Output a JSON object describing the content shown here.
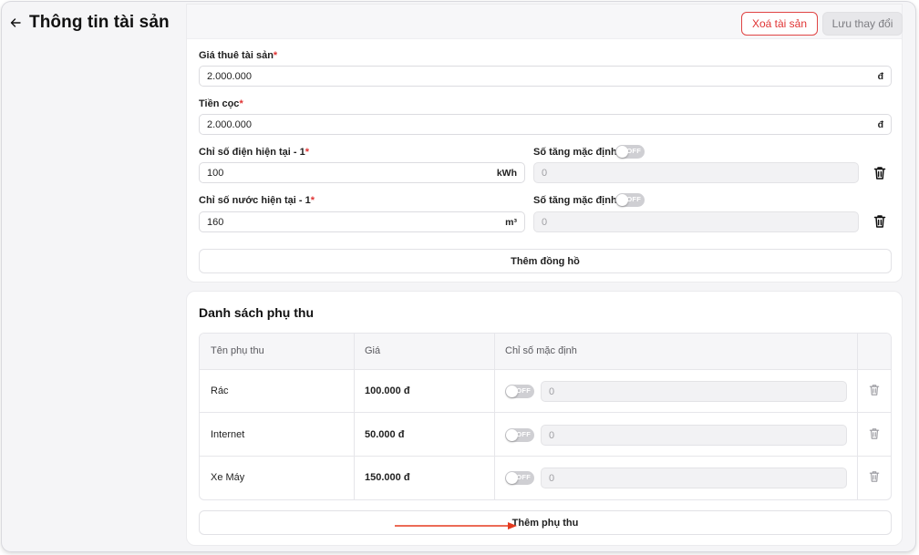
{
  "header": {
    "title": "Thông tin tài sản"
  },
  "toolbar": {
    "delete_label": "Xoá tài sản",
    "save_label": "Lưu thay đổi"
  },
  "rent": {
    "label": "Giá thuê tài sản",
    "value": "2.000.000",
    "unit": "đ"
  },
  "deposit": {
    "label": "Tiền cọc",
    "value": "2.000.000",
    "unit": "đ"
  },
  "meters": [
    {
      "label": "Chỉ số điện hiện tại - 1",
      "value": "100",
      "unit": "kWh",
      "default_label": "Số tăng mặc định",
      "toggle": "OFF",
      "default_value": "0"
    },
    {
      "label": "Chỉ số nước hiện tại - 1",
      "value": "160",
      "unit": "m³",
      "default_label": "Số tăng mặc định",
      "toggle": "OFF",
      "default_value": "0"
    }
  ],
  "required_mark": "*",
  "add_meter_label": "Thêm đồng hồ",
  "surcharges": {
    "title": "Danh sách phụ thu",
    "columns": [
      "Tên phụ thu",
      "Giá",
      "Chỉ số mặc định"
    ],
    "rows": [
      {
        "name": "Rác",
        "price": "100.000 đ",
        "toggle": "OFF",
        "default_value": "0"
      },
      {
        "name": "Internet",
        "price": "50.000 đ",
        "toggle": "OFF",
        "default_value": "0"
      },
      {
        "name": "Xe Máy",
        "price": "150.000 đ",
        "toggle": "OFF",
        "default_value": "0"
      }
    ],
    "add_label": "Thêm phụ thu"
  },
  "icons": {
    "back": "arrow-left-icon",
    "trash": "trash-icon",
    "annotation": "red-arrow-icon"
  },
  "colors": {
    "danger": "#e03333",
    "annotation": "#e53a1f",
    "toggle_off": "#cfcfd3"
  }
}
